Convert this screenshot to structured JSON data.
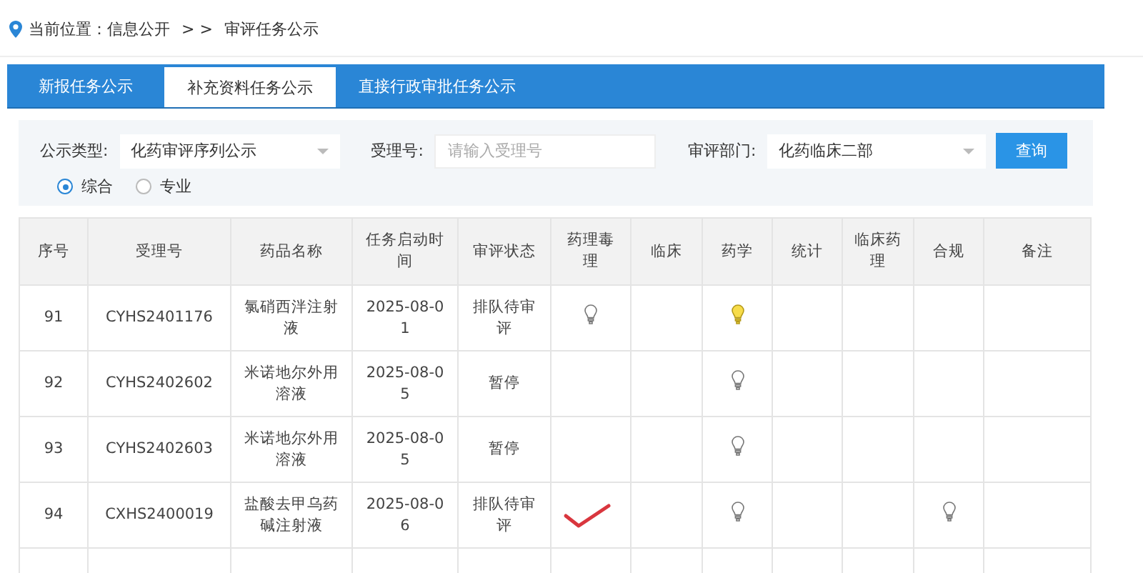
{
  "breadcrumb": {
    "label": "当前位置：信息公开",
    "separator": ">  >",
    "current": "审评任务公示"
  },
  "tabs": [
    {
      "label": "新报任务公示",
      "selected": false
    },
    {
      "label": "补充资料任务公示",
      "selected": true
    },
    {
      "label": "直接行政审批任务公示",
      "selected": false
    }
  ],
  "filters": {
    "type_label": "公示类型:",
    "type_value": "化药审评序列公示",
    "number_label": "受理号:",
    "number_placeholder": "请输入受理号",
    "dept_label": "审评部门:",
    "dept_value": "化药临床二部",
    "query_button": "查询"
  },
  "radios": [
    {
      "label": "综合",
      "selected": true
    },
    {
      "label": "专业",
      "selected": false
    }
  ],
  "table": {
    "columns": [
      "序号",
      "受理号",
      "药品名称",
      "任务启动时间",
      "审评状态",
      "药理毒理",
      "临床",
      "药学",
      "统计",
      "临床药理",
      "合规",
      "备注"
    ],
    "rows": [
      {
        "no": "91",
        "number": "CYHS2401176",
        "drug": "氯硝西泮注射液",
        "start": "2025-08-01",
        "status": "排队待审评",
        "pharmacology_lamp": {
          "lit": false
        },
        "pharmacy_lamp": {
          "lit": true
        }
      },
      {
        "no": "92",
        "number": "CYHS2402602",
        "drug": "米诺地尔外用溶液",
        "start": "2025-08-05",
        "status": "暂停",
        "pharmacy_lamp": {
          "lit": false
        }
      },
      {
        "no": "93",
        "number": "CYHS2402603",
        "drug": "米诺地尔外用溶液",
        "start": "2025-08-05",
        "status": "暂停",
        "pharmacy_lamp": {
          "lit": false
        }
      },
      {
        "no": "94",
        "number": "CXHS2400019",
        "drug": "盐酸去甲乌药碱注射液",
        "start": "2025-08-06",
        "status": "排队待审评",
        "pharmacy_lamp": {
          "lit": false
        },
        "compliance_lamp": {
          "lit": false
        },
        "check_mark": true
      }
    ]
  }
}
